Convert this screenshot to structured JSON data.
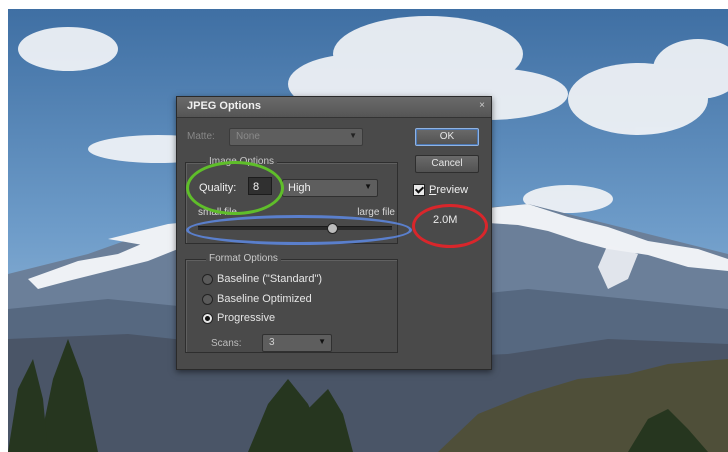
{
  "dialog": {
    "title": "JPEG Options",
    "close_glyph": "×",
    "matte": {
      "label": "Matte:",
      "value": "None"
    },
    "buttons": {
      "ok": "OK",
      "cancel": "Cancel"
    },
    "preview": {
      "label_first": "P",
      "label_rest": "review",
      "checked": true
    },
    "file_size": "2.0M",
    "image_options": {
      "title": "Image Options",
      "quality_label": "Quality:",
      "quality_value": "8",
      "quality_preset": "High",
      "small_label": "small file",
      "large_label": "large file",
      "slider_fraction": 0.69
    },
    "format_options": {
      "title": "Format Options",
      "options": [
        "Baseline (\"Standard\")",
        "Baseline Optimized",
        "Progressive"
      ],
      "selected": "Progressive",
      "scans_label": "Scans:",
      "scans_value": "3"
    }
  },
  "icons": {
    "dropdown_arrow": "▼",
    "close": "close-icon",
    "check": "checkmark-icon"
  },
  "colors": {
    "highlight_quality": "#5fbe2a",
    "highlight_slider": "#5a7fcc",
    "highlight_filesize": "#d9262b",
    "dialog_bg": "#4a4a4a"
  }
}
